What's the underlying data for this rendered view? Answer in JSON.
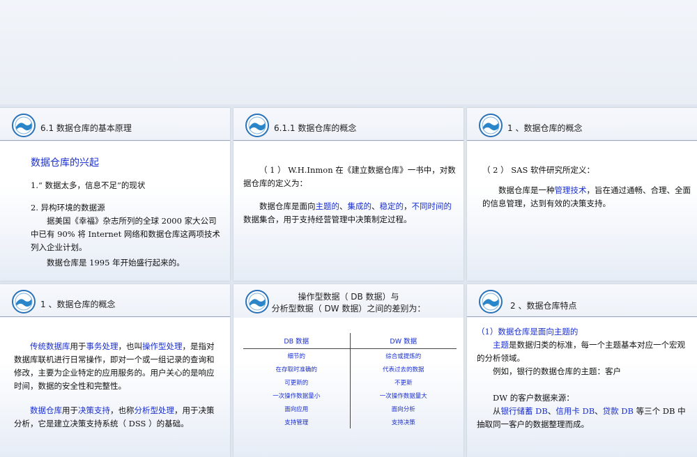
{
  "slides": [
    {
      "title": "6.1 数据仓库的基本原理",
      "heading": "数据仓库的兴起",
      "item1": "1.“ 数据太多，信息不足”的现状",
      "item2": "2.  异构环境的数据源",
      "para": "据美国《幸福》杂志所列的全球 2000 家大公司中已有 90% 将 Internet 网络和数据仓库这两项技术列入企业计划。",
      "para2": "数据仓库是 1995 年开始盛行起来的。"
    },
    {
      "title": "6.1.1 数据仓库的概念",
      "para1": "（ 1 ） W.H.Inmon 在《建立数据仓库》一书中，对数据仓库的定义为：",
      "def_prefix": "数据仓库是面向",
      "def_blue1": "主题的",
      "def_sep1": "、",
      "def_blue2": "集成的",
      "def_sep2": "、",
      "def_blue3": "稳定的",
      "def_sep3": "，",
      "def_blue4": "不同时间的",
      "def_suffix": "数据集合，用于支持经营管理中决策制定过程。"
    },
    {
      "title": "1 、数据仓库的概念",
      "para1": "（ 2 ） SAS 软件研究所定义：",
      "def_prefix": "数据仓库是一种",
      "def_blue": "管理技术",
      "def_suffix": "，旨在通过通畅、合理、全面的信息管理，达到有效的决策支持。"
    },
    {
      "title": "1 、数据仓库的概念",
      "p1_blue1": "传统数据库",
      "p1_t1": "用于",
      "p1_blue2": "事务处理",
      "p1_t2": "，也叫",
      "p1_blue3": "操作型处理",
      "p1_t3": "，是指对数据库联机进行日常操作，即对一个或一组记录的查询和修改，主要为企业特定的应用服务的。用户关心的是响应时间，数据的安全性和完整性。",
      "p2_blue1": "数据仓库",
      "p2_t1": "用于",
      "p2_blue2": "决策支持",
      "p2_t2": "，也称",
      "p2_blue3": "分析型处理",
      "p2_t3": "，用于决策分析，它是建立决策支持系统（ DSS ）的基础。"
    },
    {
      "title_line1": "操作型数据（ DB 数据）与",
      "title_line2": "分析型数据（ DW 数据）之间的差别为：",
      "table": {
        "headers": [
          "DB 数据",
          "DW 数据"
        ],
        "rows": [
          [
            "细节的",
            "综合或提炼的"
          ],
          [
            "在存取时准确的",
            "代表过去的数据"
          ],
          [
            "可更新的",
            "不更新"
          ],
          [
            "一次操作数据量小",
            "一次操作数据量大"
          ],
          [
            "面向应用",
            "面向分析"
          ],
          [
            "支持管理",
            "支持决策"
          ]
        ]
      }
    },
    {
      "title": "2 、数据仓库特点",
      "heading": "（1）数据仓库是面向主题的",
      "p1_blue": "主题",
      "p1_t": "是数据归类的标准，每一个主题基本对应一个宏观的分析领域。",
      "p2": "例如，银行的数据仓库的主题：客户",
      "p3": "DW 的客户数据来源：",
      "p4_t1": "从",
      "p4_blue1": "银行储蓄 DB",
      "p4_sep1": "、",
      "p4_blue2": "信用卡 DB",
      "p4_sep2": "、",
      "p4_blue3": "贷款 DB",
      "p4_t2": " 等三个 DB 中抽取同一客户的数据整理而成。"
    }
  ]
}
